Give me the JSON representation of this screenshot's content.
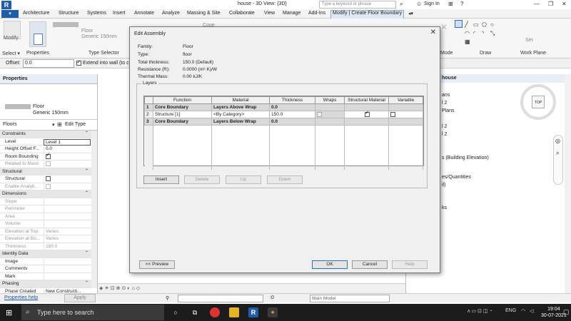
{
  "titlebar": {
    "app_logo": "R",
    "document": "house - 3D View: {3D}",
    "keyword_placeholder": "Type a keyword or phrase",
    "sign_in": "Sign In",
    "help": "?"
  },
  "ribbon": {
    "tabs": [
      "Architecture",
      "Structure",
      "Systems",
      "Insert",
      "Annotate",
      "Analyze",
      "Massing & Site",
      "Collaborate",
      "View",
      "Manage",
      "Add-Ins",
      "Modify | Create Floor Boundary"
    ],
    "panels": {
      "modify": "Modify",
      "select": "Select ▾",
      "properties": "Properties",
      "type_selector": "Type Selector",
      "type_name": "Floor",
      "type_sub": "Generic 150mm",
      "mode": "Mode",
      "draw": "Draw",
      "work_plane": "Work Plane",
      "set": "Set",
      "cope": "Cope"
    }
  },
  "optbar": {
    "offset_label": "Offset:",
    "offset_value": "0.0",
    "extend_label": "Extend into wall (to c"
  },
  "properties": {
    "title": "Properties",
    "type_name": "Floor",
    "type_sub": "Generic 150mm",
    "category": "Floors",
    "edit_type": "Edit Type",
    "help": "Properties help",
    "apply": "Apply",
    "groups": [
      {
        "name": "Constraints",
        "rows": [
          {
            "k": "Level",
            "v": "Level 1"
          },
          {
            "k": "Height Offset F...",
            "v": "0.0"
          },
          {
            "k": "Room Bounding",
            "check": true
          },
          {
            "k": "Related to Mass",
            "check": false,
            "dim": true
          }
        ]
      },
      {
        "name": "Structural",
        "rows": [
          {
            "k": "Structural",
            "check": false
          },
          {
            "k": "Enable Analyti...",
            "check": false,
            "dim": true
          }
        ]
      },
      {
        "name": "Dimensions",
        "rows": [
          {
            "k": "Slope",
            "v": "",
            "dim": true
          },
          {
            "k": "Perimeter",
            "v": "",
            "dim": true
          },
          {
            "k": "Area",
            "v": "",
            "dim": true
          },
          {
            "k": "Volume",
            "v": "",
            "dim": true
          },
          {
            "k": "Elevation at Top",
            "v": "Varies",
            "dim": true
          },
          {
            "k": "Elevation at Bo...",
            "v": "Varies",
            "dim": true
          },
          {
            "k": "Thickness",
            "v": "150.0",
            "dim": true
          }
        ]
      },
      {
        "name": "Identity Data",
        "rows": [
          {
            "k": "Image",
            "v": ""
          },
          {
            "k": "Comments",
            "v": ""
          },
          {
            "k": "Mark",
            "v": ""
          }
        ]
      },
      {
        "name": "Phasing",
        "rows": [
          {
            "k": "Phase Created",
            "v": "New Constructi..."
          }
        ]
      }
    ]
  },
  "browser": {
    "title": "house",
    "items": [
      "ans",
      "l 2",
      "Plans",
      "l 2",
      "s (Building Elevation)",
      "es/Quantities",
      "il)",
      "ks"
    ],
    "cube_label": "TOP"
  },
  "dialog": {
    "title": "Edit Assembly",
    "info": [
      {
        "k": "Family:",
        "v": "Floor"
      },
      {
        "k": "Type:",
        "v": "floor"
      },
      {
        "k": "Total thickness:",
        "v": "150.0 (Default)"
      },
      {
        "k": "Resistance (R):",
        "v": "0.0000 (m²·K)/W"
      },
      {
        "k": "Thermal Mass:",
        "v": "0.00 kJ/K"
      }
    ],
    "layers_label": "Layers",
    "columns": [
      "",
      "Function",
      "Material",
      "Thickness",
      "Wraps",
      "Structural Material",
      "Variable"
    ],
    "rows": [
      {
        "n": "1",
        "function": "Core Boundary",
        "material": "Layers Above Wrap",
        "thickness": "0.0"
      },
      {
        "n": "2",
        "function": "Structure [1]",
        "material": "<By Category>",
        "thickness": "150.0"
      },
      {
        "n": "3",
        "function": "Core Boundary",
        "material": "Layers Below Wrap",
        "thickness": "0.0"
      }
    ],
    "buttons": {
      "insert": "Insert",
      "delete": "Delete",
      "up": "Up",
      "down": "Down",
      "preview": "<< Preview",
      "ok": "OK",
      "cancel": "Cancel",
      "help": "Help"
    }
  },
  "status": {
    "scale_value": ":0",
    "main_model": "Main Model"
  },
  "taskbar": {
    "search": "Type here to search",
    "lang": "ENG",
    "time": "19:04",
    "date": "30-07-2021"
  }
}
